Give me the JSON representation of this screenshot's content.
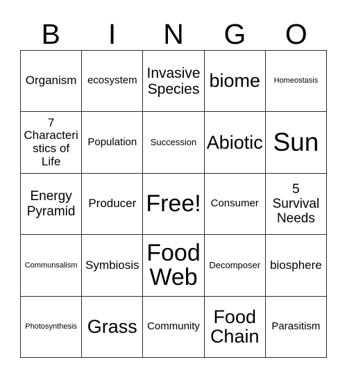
{
  "card": {
    "header_letters": [
      "B",
      "I",
      "N",
      "G",
      "O"
    ],
    "rows": [
      [
        {
          "text": "Organism",
          "size": "fs-lg"
        },
        {
          "text": "ecosystem",
          "size": "fs-md"
        },
        {
          "text": "Invasive Species",
          "size": "fs-2xl"
        },
        {
          "text": "biome",
          "size": "fs-3xl"
        },
        {
          "text": "Homeostasis",
          "size": "fs-xs"
        }
      ],
      [
        {
          "text": "7 Characteristics of Life",
          "size": "fs-lg"
        },
        {
          "text": "Population",
          "size": "fs-md"
        },
        {
          "text": "Succession",
          "size": "fs-sm"
        },
        {
          "text": "Abiotic",
          "size": "fs-3xl"
        },
        {
          "text": "Sun",
          "size": "fs-5xl"
        }
      ],
      [
        {
          "text": "Energy Pyramid",
          "size": "fs-xl"
        },
        {
          "text": "Producer",
          "size": "fs-lg"
        },
        {
          "text": "Free!",
          "size": "fs-4xl"
        },
        {
          "text": "Consumer",
          "size": "fs-md"
        },
        {
          "text": "5 Survival Needs",
          "size": "fs-xl"
        }
      ],
      [
        {
          "text": "Communsalism",
          "size": "fs-xs"
        },
        {
          "text": "Symbiosis",
          "size": "fs-lg"
        },
        {
          "text": "Food Web",
          "size": "fs-4xl"
        },
        {
          "text": "Decomposer",
          "size": "fs-sm"
        },
        {
          "text": "biosphere",
          "size": "fs-lg"
        }
      ],
      [
        {
          "text": "Photosynthesis",
          "size": "fs-xs"
        },
        {
          "text": "Grass",
          "size": "fs-3xl"
        },
        {
          "text": "Community",
          "size": "fs-md"
        },
        {
          "text": "Food Chain",
          "size": "fs-3xl"
        },
        {
          "text": "Parasitism",
          "size": "fs-md"
        }
      ]
    ],
    "free_space": {
      "row": 2,
      "col": 2
    },
    "colors": {
      "background": "#ffffff",
      "border": "#2b2b2b",
      "text": "#000000"
    }
  }
}
